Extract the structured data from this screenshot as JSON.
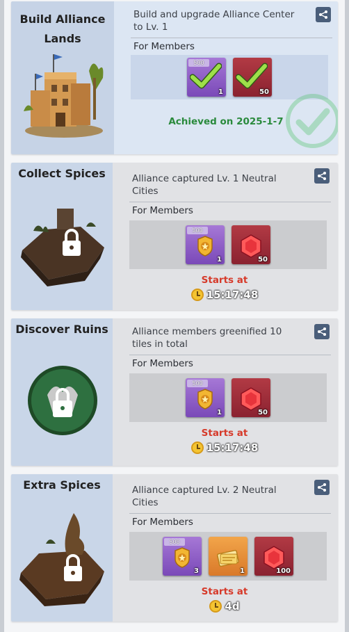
{
  "quests": [
    {
      "title": "Build Alliance Lands",
      "description": "Build and upgrade Alliance Center to Lv. 1",
      "members_label": "For Members",
      "status": "Achieved on 2025-1-7",
      "rewards": [
        {
          "type": "purple",
          "icon": "badge-icon",
          "tag": "500",
          "count": "1",
          "claimed": true
        },
        {
          "type": "red",
          "icon": "ruby-icon",
          "count": "50",
          "claimed": true
        }
      ]
    },
    {
      "title": "Collect Spices",
      "description": "Alliance captured Lv. 1 Neutral Cities",
      "members_label": "For Members",
      "status": "Starts at",
      "timer": "15:17:48",
      "rewards": [
        {
          "type": "purple",
          "icon": "badge-icon",
          "tag": "500",
          "count": "1"
        },
        {
          "type": "red",
          "icon": "ruby-icon",
          "count": "50"
        }
      ]
    },
    {
      "title": "Discover Ruins",
      "description": "Alliance members greenified 10 tiles in total",
      "members_label": "For Members",
      "status": "Starts at",
      "timer": "15:17:48",
      "rewards": [
        {
          "type": "purple",
          "icon": "badge-icon",
          "tag": "500",
          "count": "1"
        },
        {
          "type": "red",
          "icon": "ruby-icon",
          "count": "50"
        }
      ]
    },
    {
      "title": "Extra Spices",
      "description": "Alliance captured Lv. 2 Neutral Cities",
      "members_label": "For Members",
      "status": "Starts at",
      "timer": "4d",
      "rewards": [
        {
          "type": "purple",
          "icon": "badge-icon",
          "tag": "500",
          "count": "3"
        },
        {
          "type": "orange",
          "icon": "scroll-icon",
          "count": "1"
        },
        {
          "type": "red",
          "icon": "ruby-icon",
          "count": "100"
        }
      ]
    }
  ],
  "colors": {
    "achieved": "#2a8a3c",
    "starts": "#d63a2a",
    "share_button": "#4a5e7a"
  }
}
